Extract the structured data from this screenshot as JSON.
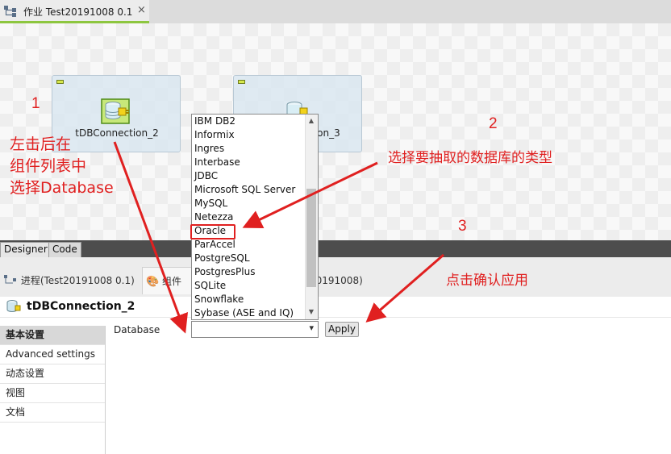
{
  "editor_tab": {
    "title": "作业 Test20191008 0.1",
    "close": "×"
  },
  "canvas": {
    "components": [
      {
        "label": "tDBConnection_2"
      },
      {
        "label": "tDBConnection_3"
      }
    ]
  },
  "dropdown": {
    "options": [
      "IBM DB2",
      "Informix",
      "Ingres",
      "Interbase",
      "JDBC",
      "Microsoft SQL Server",
      "MySQL",
      "Netezza",
      "Oracle",
      "ParAccel",
      "PostgreSQL",
      "PostgresPlus",
      "SQLite",
      "Snowflake",
      "Sybase (ASE and IQ)"
    ],
    "highlighted": "Oracle"
  },
  "view_tabs": {
    "designer": "Designer",
    "code": "Code"
  },
  "props_tabs": {
    "process": "进程(Test20191008 0.1)",
    "component": "组件",
    "third": "20191008)"
  },
  "props_header": {
    "title": "tDBConnection_2"
  },
  "side_menu": {
    "items": [
      "基本设置",
      "Advanced settings",
      "动态设置",
      "视图",
      "文档"
    ]
  },
  "form": {
    "database_label": "Database",
    "database_value": "",
    "caret": "▾",
    "apply_label": "Apply"
  },
  "annotations": {
    "step1_num": "1",
    "step1_line1": "左击后在",
    "step1_line2": "组件列表中",
    "step1_line3": "选择Database",
    "step2_num": "2",
    "step2_text": "选择要抽取的数据库的类型",
    "step3_num": "3",
    "step3_text": "点击确认应用"
  },
  "colors": {
    "accent_green": "#8dc63f",
    "annotation_red": "#e02020"
  }
}
